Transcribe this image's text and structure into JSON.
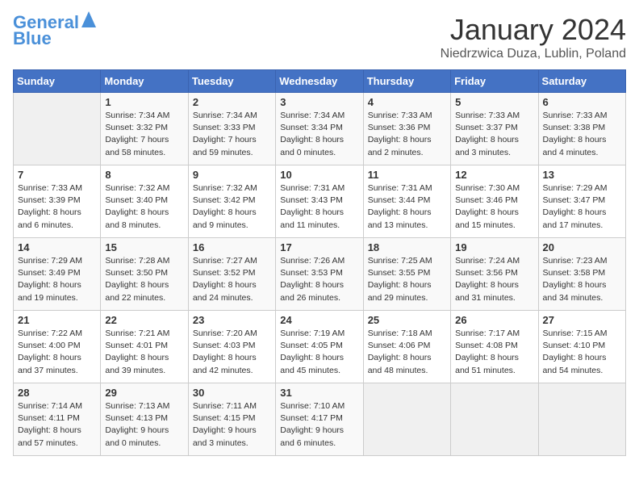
{
  "header": {
    "logo_line1": "General",
    "logo_line2": "Blue",
    "title": "January 2024",
    "location": "Niedrzwica Duza, Lublin, Poland"
  },
  "calendar": {
    "days_of_week": [
      "Sunday",
      "Monday",
      "Tuesday",
      "Wednesday",
      "Thursday",
      "Friday",
      "Saturday"
    ],
    "weeks": [
      [
        {
          "day": "",
          "info": ""
        },
        {
          "day": "1",
          "info": "Sunrise: 7:34 AM\nSunset: 3:32 PM\nDaylight: 7 hours\nand 58 minutes."
        },
        {
          "day": "2",
          "info": "Sunrise: 7:34 AM\nSunset: 3:33 PM\nDaylight: 7 hours\nand 59 minutes."
        },
        {
          "day": "3",
          "info": "Sunrise: 7:34 AM\nSunset: 3:34 PM\nDaylight: 8 hours\nand 0 minutes."
        },
        {
          "day": "4",
          "info": "Sunrise: 7:33 AM\nSunset: 3:36 PM\nDaylight: 8 hours\nand 2 minutes."
        },
        {
          "day": "5",
          "info": "Sunrise: 7:33 AM\nSunset: 3:37 PM\nDaylight: 8 hours\nand 3 minutes."
        },
        {
          "day": "6",
          "info": "Sunrise: 7:33 AM\nSunset: 3:38 PM\nDaylight: 8 hours\nand 4 minutes."
        }
      ],
      [
        {
          "day": "7",
          "info": "Sunrise: 7:33 AM\nSunset: 3:39 PM\nDaylight: 8 hours\nand 6 minutes."
        },
        {
          "day": "8",
          "info": "Sunrise: 7:32 AM\nSunset: 3:40 PM\nDaylight: 8 hours\nand 8 minutes."
        },
        {
          "day": "9",
          "info": "Sunrise: 7:32 AM\nSunset: 3:42 PM\nDaylight: 8 hours\nand 9 minutes."
        },
        {
          "day": "10",
          "info": "Sunrise: 7:31 AM\nSunset: 3:43 PM\nDaylight: 8 hours\nand 11 minutes."
        },
        {
          "day": "11",
          "info": "Sunrise: 7:31 AM\nSunset: 3:44 PM\nDaylight: 8 hours\nand 13 minutes."
        },
        {
          "day": "12",
          "info": "Sunrise: 7:30 AM\nSunset: 3:46 PM\nDaylight: 8 hours\nand 15 minutes."
        },
        {
          "day": "13",
          "info": "Sunrise: 7:29 AM\nSunset: 3:47 PM\nDaylight: 8 hours\nand 17 minutes."
        }
      ],
      [
        {
          "day": "14",
          "info": "Sunrise: 7:29 AM\nSunset: 3:49 PM\nDaylight: 8 hours\nand 19 minutes."
        },
        {
          "day": "15",
          "info": "Sunrise: 7:28 AM\nSunset: 3:50 PM\nDaylight: 8 hours\nand 22 minutes."
        },
        {
          "day": "16",
          "info": "Sunrise: 7:27 AM\nSunset: 3:52 PM\nDaylight: 8 hours\nand 24 minutes."
        },
        {
          "day": "17",
          "info": "Sunrise: 7:26 AM\nSunset: 3:53 PM\nDaylight: 8 hours\nand 26 minutes."
        },
        {
          "day": "18",
          "info": "Sunrise: 7:25 AM\nSunset: 3:55 PM\nDaylight: 8 hours\nand 29 minutes."
        },
        {
          "day": "19",
          "info": "Sunrise: 7:24 AM\nSunset: 3:56 PM\nDaylight: 8 hours\nand 31 minutes."
        },
        {
          "day": "20",
          "info": "Sunrise: 7:23 AM\nSunset: 3:58 PM\nDaylight: 8 hours\nand 34 minutes."
        }
      ],
      [
        {
          "day": "21",
          "info": "Sunrise: 7:22 AM\nSunset: 4:00 PM\nDaylight: 8 hours\nand 37 minutes."
        },
        {
          "day": "22",
          "info": "Sunrise: 7:21 AM\nSunset: 4:01 PM\nDaylight: 8 hours\nand 39 minutes."
        },
        {
          "day": "23",
          "info": "Sunrise: 7:20 AM\nSunset: 4:03 PM\nDaylight: 8 hours\nand 42 minutes."
        },
        {
          "day": "24",
          "info": "Sunrise: 7:19 AM\nSunset: 4:05 PM\nDaylight: 8 hours\nand 45 minutes."
        },
        {
          "day": "25",
          "info": "Sunrise: 7:18 AM\nSunset: 4:06 PM\nDaylight: 8 hours\nand 48 minutes."
        },
        {
          "day": "26",
          "info": "Sunrise: 7:17 AM\nSunset: 4:08 PM\nDaylight: 8 hours\nand 51 minutes."
        },
        {
          "day": "27",
          "info": "Sunrise: 7:15 AM\nSunset: 4:10 PM\nDaylight: 8 hours\nand 54 minutes."
        }
      ],
      [
        {
          "day": "28",
          "info": "Sunrise: 7:14 AM\nSunset: 4:11 PM\nDaylight: 8 hours\nand 57 minutes."
        },
        {
          "day": "29",
          "info": "Sunrise: 7:13 AM\nSunset: 4:13 PM\nDaylight: 9 hours\nand 0 minutes."
        },
        {
          "day": "30",
          "info": "Sunrise: 7:11 AM\nSunset: 4:15 PM\nDaylight: 9 hours\nand 3 minutes."
        },
        {
          "day": "31",
          "info": "Sunrise: 7:10 AM\nSunset: 4:17 PM\nDaylight: 9 hours\nand 6 minutes."
        },
        {
          "day": "",
          "info": ""
        },
        {
          "day": "",
          "info": ""
        },
        {
          "day": "",
          "info": ""
        }
      ]
    ]
  }
}
